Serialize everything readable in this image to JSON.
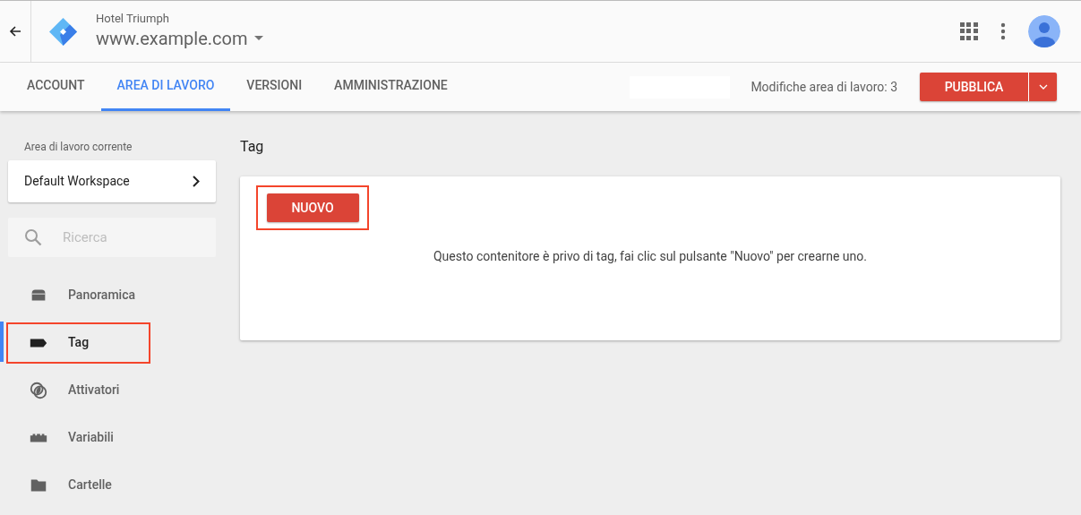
{
  "header": {
    "account": "Hotel Triumph",
    "container": "www.example.com"
  },
  "tabs": [
    {
      "label": "ACCOUNT",
      "selected": false
    },
    {
      "label": "AREA DI LAVORO",
      "selected": true
    },
    {
      "label": "VERSIONI",
      "selected": false
    },
    {
      "label": "AMMINISTRAZIONE",
      "selected": false
    }
  ],
  "workspace_changes": "Modifiche area di lavoro: 3",
  "publish_button": "PUBBLICA",
  "sidebar": {
    "workspace_label": "Area di lavoro corrente",
    "workspace": "Default Workspace",
    "search": {
      "placeholder": "Ricerca"
    },
    "items": [
      {
        "label": "Panoramica",
        "kind": "overview",
        "selected": false,
        "highlighted": false
      },
      {
        "label": "Tag",
        "kind": "tag",
        "selected": true,
        "highlighted": true
      },
      {
        "label": "Attivatori",
        "kind": "trigger",
        "selected": false,
        "highlighted": false
      },
      {
        "label": "Variabili",
        "kind": "variable",
        "selected": false,
        "highlighted": false
      },
      {
        "label": "Cartelle",
        "kind": "folder",
        "selected": false,
        "highlighted": false
      }
    ]
  },
  "main": {
    "title": "Tag",
    "new_button": {
      "label": "NUOVO",
      "highlighted": true
    },
    "empty_message": "Questo contenitore è privo di tag, fai clic sul pulsante \"Nuovo\" per crearne uno."
  }
}
